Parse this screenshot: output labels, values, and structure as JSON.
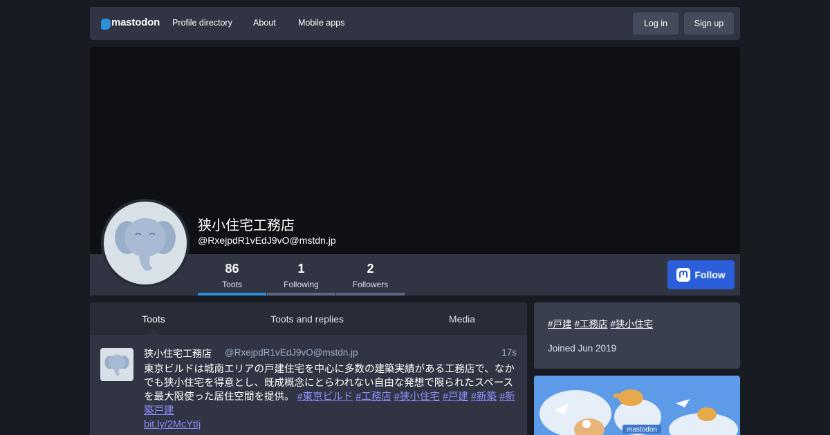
{
  "nav": {
    "logo_text": "mastodon",
    "links": [
      "Profile directory",
      "About",
      "Mobile apps"
    ],
    "login_label": "Log in",
    "signup_label": "Sign up"
  },
  "profile": {
    "display_name": "狭小住宅工務店",
    "handle": "@RxejpdR1vEdJ9vO@mstdn.jp",
    "stats": [
      {
        "count": "86",
        "label": "Toots"
      },
      {
        "count": "1",
        "label": "Following"
      },
      {
        "count": "2",
        "label": "Followers"
      }
    ],
    "follow_label": "Follow"
  },
  "tabs": [
    "Toots",
    "Toots and replies",
    "Media"
  ],
  "status": {
    "name": "狭小住宅工務店",
    "acct": "@RxejpdR1vEdJ9vO@mstdn.jp",
    "time": "17s",
    "text": "東京ビルドは城南エリアの戸建住宅を中心に多数の建築実績がある工務店で、なかでも狭小住宅を得意とし、既成概念にとらわれない自由な発想で限られたスペースを最大限使った居住空間を提供。",
    "hashtags": [
      "#東京ビルド",
      "#工務店",
      "#狭小住宅",
      "#戸建",
      "#新築",
      "#新築戸建"
    ],
    "link": "bit.ly/2McYtIj"
  },
  "sidebar": {
    "tags": [
      "#戸建",
      "#工務店",
      "#狭小住宅"
    ],
    "joined": "Joined Jun 2019",
    "illustration_logo": "mastodon"
  },
  "colors": {
    "accent": "#2b90d9",
    "follow": "#2b5fd9",
    "background": "#191b22",
    "panel": "#313543"
  }
}
